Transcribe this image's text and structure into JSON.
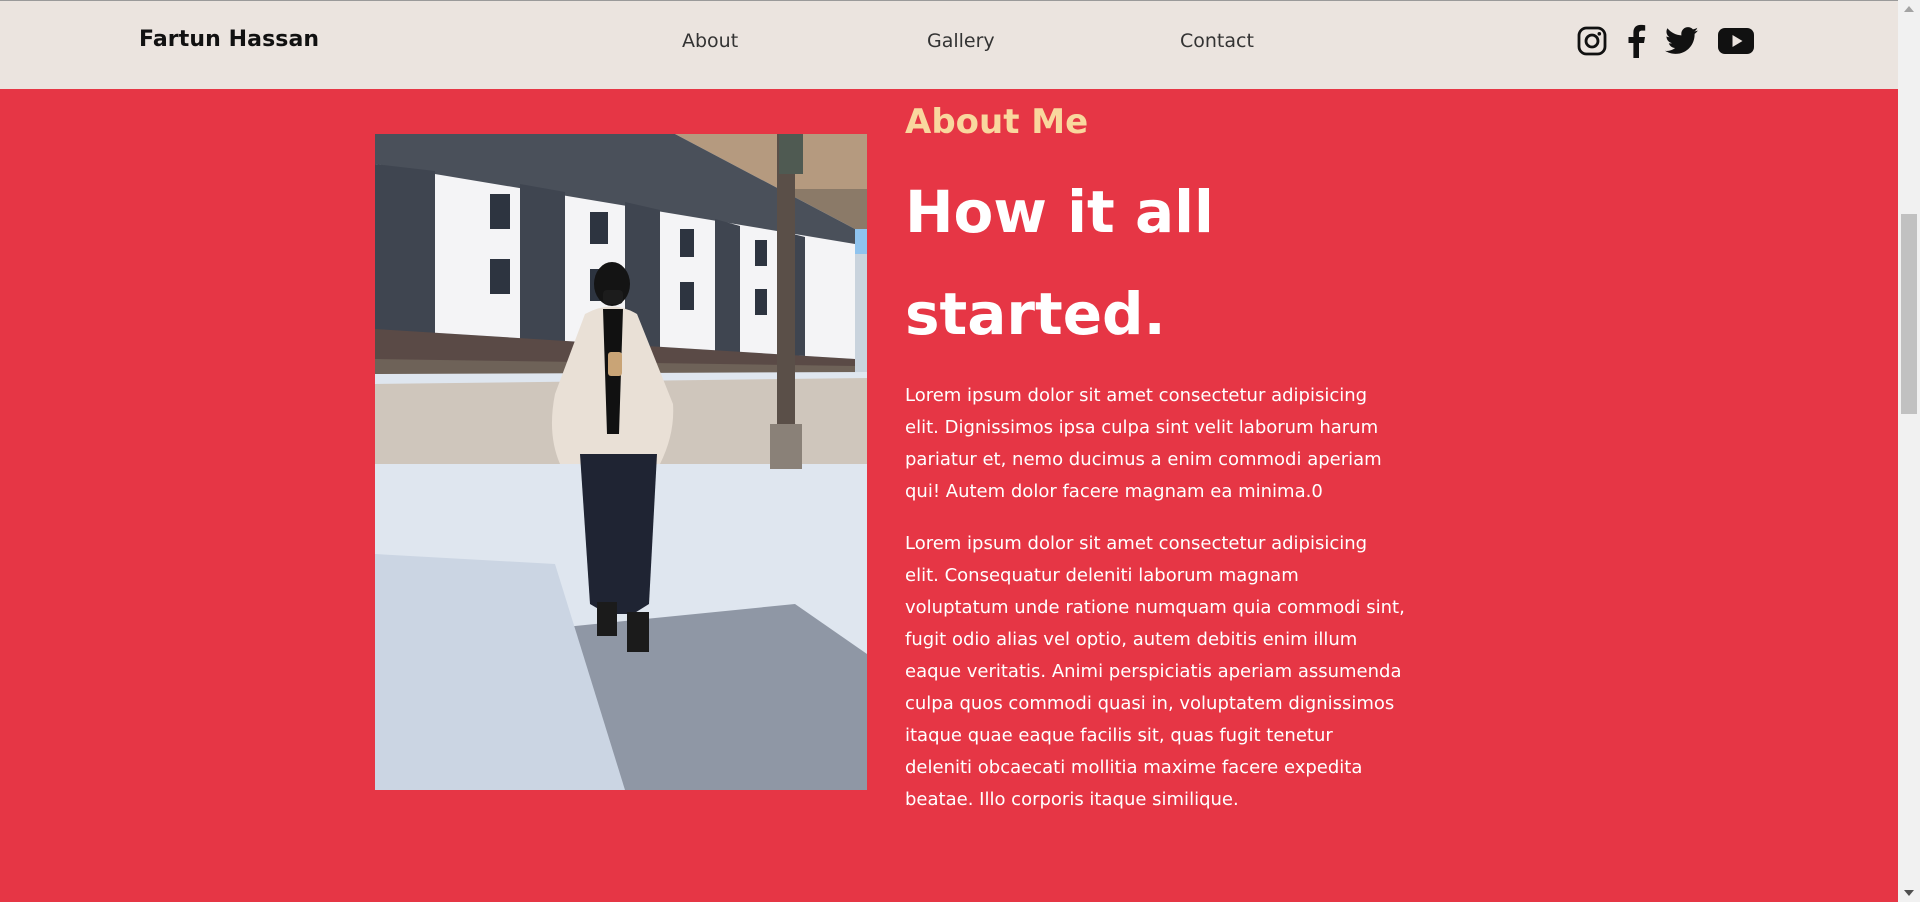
{
  "header": {
    "brand": "Fartun Hassan",
    "nav": [
      {
        "label": "About"
      },
      {
        "label": "Gallery"
      },
      {
        "label": "Contact"
      }
    ],
    "social_icons": [
      "instagram-icon",
      "facebook-icon",
      "twitter-icon",
      "youtube-icon"
    ]
  },
  "about": {
    "eyebrow": "About Me",
    "headline": "How it all started.",
    "paragraphs": [
      "Lorem ipsum dolor sit amet consectetur adipisicing elit. Dignissimos ipsa culpa sint velit laborum harum pariatur et, nemo ducimus a enim commodi aperiam qui! Autem dolor facere magnam ea minima.0",
      "Lorem ipsum dolor sit amet consectetur adipisicing elit. Consequatur deleniti laborum magnam voluptatum unde ratione numquam quia commodi sint, fugit odio alias vel optio, autem debitis enim illum eaque veritatis. Animi perspiciatis aperiam assumenda culpa quos commodi quasi in, voluptatem dignissimos itaque quae eaque facilis sit, quas fugit tenetur deleniti obcaecati mollitia maxime facere expedita beatae. Illo corporis itaque similique."
    ]
  },
  "colors": {
    "header_bg": "#ebe4df",
    "section_bg": "#e63645",
    "accent": "#f9d79e",
    "text_light": "#ffffff"
  }
}
